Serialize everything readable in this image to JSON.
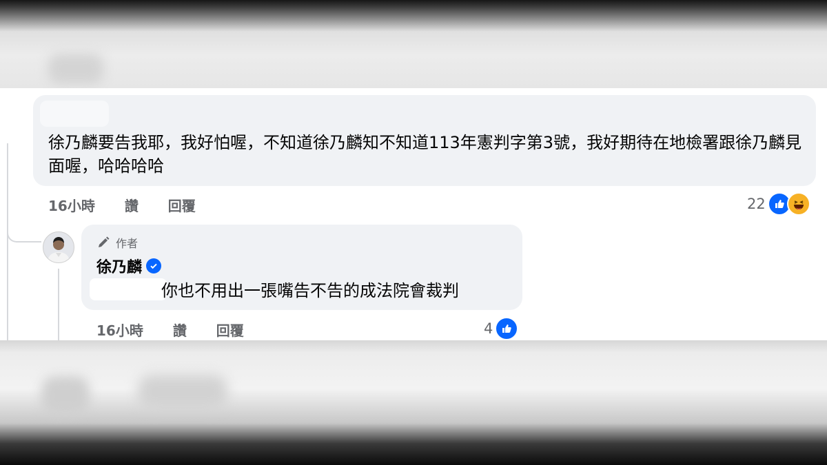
{
  "comment": {
    "text": "徐乃麟要告我耶，我好怕喔，不知道徐乃麟知不知道113年憲判字第3號，我好期待在地檢署跟徐乃麟見面喔，哈哈哈哈",
    "time": "16小時",
    "like_label": "讚",
    "reply_label": "回覆",
    "reaction_count": "22",
    "reaction_icons": [
      "like-icon",
      "haha-icon"
    ]
  },
  "reply": {
    "badge": "作者",
    "author": "徐乃麟",
    "text": "你也不用出一張嘴告不告的成法院會裁判",
    "time": "16小時",
    "like_label": "讚",
    "reply_label": "回覆",
    "reaction_count": "4",
    "reaction_icons": [
      "like-icon"
    ]
  },
  "colors": {
    "bubble": "#f0f2f5",
    "meta_text": "#65676b",
    "accent": "#0866ff"
  }
}
